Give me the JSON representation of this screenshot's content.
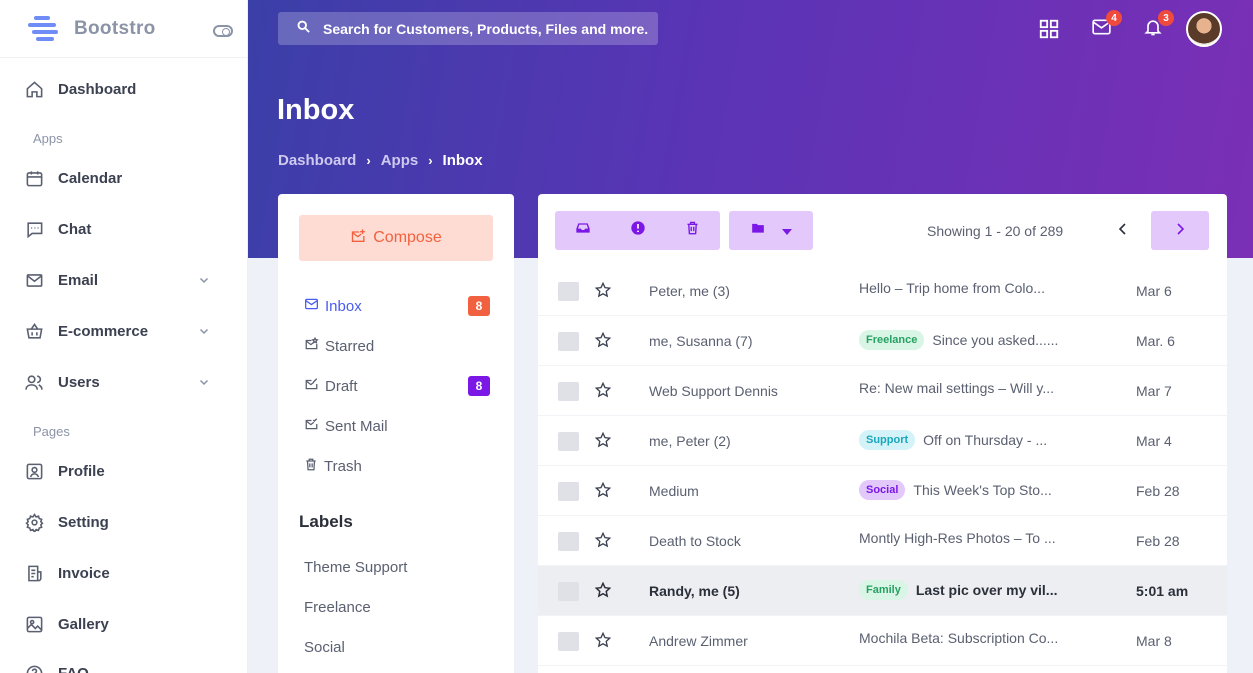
{
  "brand": {
    "name": "Bootstro"
  },
  "sidebar": {
    "items": [
      {
        "label": "Dashboard",
        "icon": "home-icon"
      },
      {
        "label": "Calendar",
        "icon": "calendar-icon"
      },
      {
        "label": "Chat",
        "icon": "chat-icon"
      },
      {
        "label": "Email",
        "icon": "mail-icon",
        "expandable": true
      },
      {
        "label": "E-commerce",
        "icon": "basket-icon",
        "expandable": true
      },
      {
        "label": "Users",
        "icon": "users-icon",
        "expandable": true
      },
      {
        "label": "Profile",
        "icon": "profile-icon"
      },
      {
        "label": "Setting",
        "icon": "gear-icon"
      },
      {
        "label": "Invoice",
        "icon": "invoice-icon"
      },
      {
        "label": "Gallery",
        "icon": "image-icon"
      },
      {
        "label": "FAQ",
        "icon": "help-icon"
      }
    ],
    "sections": [
      "Apps",
      "Pages"
    ]
  },
  "header": {
    "search_placeholder": "Search for Customers, Products, Files and more.",
    "mail_badge": "4",
    "notification_badge": "3"
  },
  "page": {
    "title": "Inbox",
    "breadcrumb": [
      "Dashboard",
      "Apps",
      "Inbox"
    ]
  },
  "mail": {
    "compose_label": "Compose",
    "folders": [
      {
        "label": "Inbox",
        "count": "8",
        "count_color": "#f2613f"
      },
      {
        "label": "Starred"
      },
      {
        "label": "Draft",
        "count": "8",
        "count_color": "#7b18e6"
      },
      {
        "label": "Sent Mail"
      },
      {
        "label": "Trash"
      }
    ],
    "labels_title": "Labels",
    "labels": [
      "Theme Support",
      "Freelance",
      "Social"
    ]
  },
  "list": {
    "showing": "Showing 1 - 20 of 289",
    "rows": [
      {
        "sender": "Peter, me (3)",
        "tag": "",
        "subject": "Hello – Trip home from Colo...",
        "date": "Mar 6"
      },
      {
        "sender": "me, Susanna (7)",
        "tag": "Freelance",
        "subject": "Since you asked......",
        "date": "Mar. 6"
      },
      {
        "sender": "Web Support Dennis",
        "tag": "",
        "subject": "Re: New mail settings – Will y...",
        "date": "Mar 7"
      },
      {
        "sender": "me, Peter (2)",
        "tag": "Support",
        "subject": "Off on Thursday - ...",
        "date": "Mar 4"
      },
      {
        "sender": "Medium",
        "tag": "Social",
        "subject": "This Week's Top Sto...",
        "date": "Feb 28"
      },
      {
        "sender": "Death to Stock",
        "tag": "",
        "subject": "Montly High-Res Photos – To ...",
        "date": "Feb 28"
      },
      {
        "sender": "Randy, me (5)",
        "tag": "Family",
        "subject": "Last pic over my vil...",
        "date": "5:01 am"
      },
      {
        "sender": "Andrew Zimmer",
        "tag": "",
        "subject": "Mochila Beta: Subscription Co...",
        "date": "Mar 8"
      }
    ]
  },
  "colors": {
    "accent": "#4a5cf0",
    "compose_bg": "#ffdcd3",
    "compose_text": "#f2613f",
    "toolbar_bg": "#e3c8fb",
    "toolbar_icon": "#7b18e6",
    "tag_freelance": "#d9f5e5",
    "tag_support": "#d3f3f8",
    "tag_social": "#e3c8fb",
    "tag_family": "#d9f5e5"
  }
}
